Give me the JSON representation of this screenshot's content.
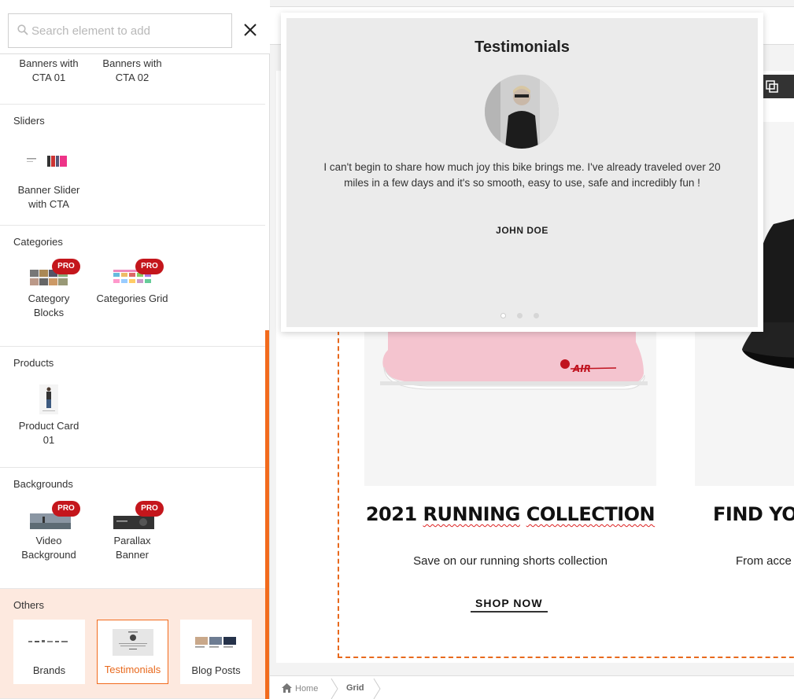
{
  "search": {
    "placeholder": "Search element to add"
  },
  "sections": {
    "banners": {
      "items": [
        {
          "label": "Banners with CTA 01"
        },
        {
          "label": "Banners with CTA 02"
        }
      ]
    },
    "sliders": {
      "title": "Sliders",
      "items": [
        {
          "label": "Banner Slider with CTA"
        }
      ]
    },
    "categories": {
      "title": "Categories",
      "items": [
        {
          "label": "Category Blocks",
          "badge": "PRO"
        },
        {
          "label": "Categories Grid",
          "badge": "PRO"
        }
      ]
    },
    "products": {
      "title": "Products",
      "items": [
        {
          "label": "Product Card 01"
        }
      ]
    },
    "backgrounds": {
      "title": "Backgrounds",
      "items": [
        {
          "label": "Video Background",
          "badge": "PRO"
        },
        {
          "label": "Parallax Banner",
          "badge": "PRO"
        }
      ]
    },
    "others": {
      "title": "Others",
      "items": [
        {
          "label": "Brands"
        },
        {
          "label": "Testimonials",
          "selected": true
        },
        {
          "label": "Blog Posts"
        }
      ]
    }
  },
  "preview": {
    "title": "Testimonials",
    "quote": "I can't begin to share how much joy this bike brings me. I've already traveled over 20 miles in a few days and it's so smooth, easy to use, safe and incredibly fun !",
    "author": "JOHN DOE",
    "dots": 3,
    "active_dot": 1
  },
  "canvas": {
    "collection_title_1": "2021",
    "collection_title_2": "RUNNING",
    "collection_title_3": "COLLECTION",
    "collection_subtitle": "Save on our running shorts collection",
    "shop_now": "SHOP NOW",
    "second_title": "FIND YOU",
    "second_subtitle": "From acce",
    "shoe_logo": "AIR"
  },
  "breadcrumb": {
    "home": "Home",
    "current": "Grid"
  },
  "colors": {
    "accent": "#f26b1d",
    "pro_badge": "#c4161c",
    "others_bg": "#fde9df"
  }
}
